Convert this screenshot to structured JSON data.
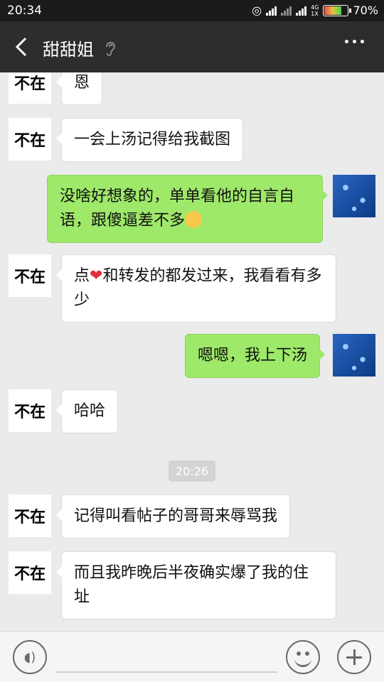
{
  "status_bar": {
    "time": "20:34",
    "network": "4G",
    "network_sub": "1X",
    "battery_percent": "70%",
    "battery_level": 0.7
  },
  "header": {
    "back_icon": "chevron-left-icon",
    "title": "甜甜姐",
    "mode_icon": "ear-icon",
    "more_icon": "more-dots-icon"
  },
  "contact": {
    "avatar_text": "不在"
  },
  "messages": [
    {
      "side": "in",
      "text": "恩"
    },
    {
      "side": "in",
      "text": "一会上汤记得给我截图"
    },
    {
      "side": "out",
      "text": "没啥好想象的，单单看他的自言自语，跟傻逼差不多"
    },
    {
      "side": "in",
      "text_before": "点",
      "text_after": "和转发的都发过来，我看看有多少",
      "inline_icon": "heart-icon"
    },
    {
      "side": "out",
      "text": "嗯嗯，我上下汤"
    },
    {
      "side": "in",
      "text": "哈哈"
    },
    {
      "side": "in",
      "text": "记得叫看帖子的哥哥来辱骂我"
    },
    {
      "side": "in",
      "text": "而且我昨晚后半夜确实爆了我的住址"
    }
  ],
  "timestamp": "20:26",
  "bottom_bar": {
    "voice_icon": "voice-icon",
    "emoji_icon": "emoji-icon",
    "plus_icon": "plus-icon"
  }
}
